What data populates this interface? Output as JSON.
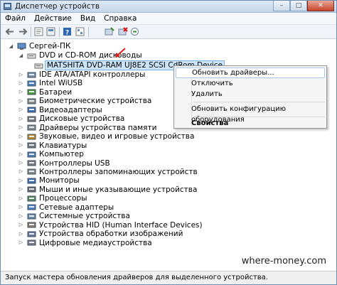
{
  "window": {
    "title": "Диспетчер устройств",
    "controls": {
      "minimize": "–",
      "maximize": "□",
      "close": "✕"
    }
  },
  "menu": [
    "Файл",
    "Действие",
    "Вид",
    "Справка"
  ],
  "toolbar": [
    "back-icon",
    "forward-icon",
    "properties-icon",
    "show-hidden-icon",
    "help-icon",
    "view-icon",
    "scan-hardware-icon",
    "disable-icon",
    "uninstall-icon"
  ],
  "tree": {
    "root": "Сергей-ПК",
    "dvd_category": "DVD и CD-ROM дисководы",
    "dvd_device": "MATSHITA DVD-RAM UJ8E2 SCSI CdRom Device",
    "categories": [
      "IDE ATA/ATAPI контроллеры",
      "Intel WiUSB",
      "Батареи",
      "Биометрические устройства",
      "Видеоадаптеры",
      "Дисковые устройства",
      "Драйверы устройства памяти",
      "Звуковые, видео и игровые устройства",
      "Клавиатуры",
      "Компьютер",
      "Контроллеры USB",
      "Контроллеры запоминающих устройств",
      "Мониторы",
      "Мыши и иные указывающие устройства",
      "Процессоры",
      "Сетевые адаптеры",
      "Системные устройства",
      "Устройства HID (Human Interface Devices)",
      "Устройства обработки изображений",
      "Цифровые медиаустройства"
    ]
  },
  "context_menu": {
    "update": "Обновить драйверы...",
    "disable": "Отключить",
    "delete": "Удалить",
    "scan": "Обновить конфигурацию оборудования",
    "properties": "Свойства"
  },
  "status": "Запуск мастера обновления драйверов для выделенного устройства.",
  "watermark": "where-money.com",
  "colors": {
    "selection": "#cce4f7",
    "arrow": "#d9201b",
    "titlebar": "#c4d6ec"
  }
}
